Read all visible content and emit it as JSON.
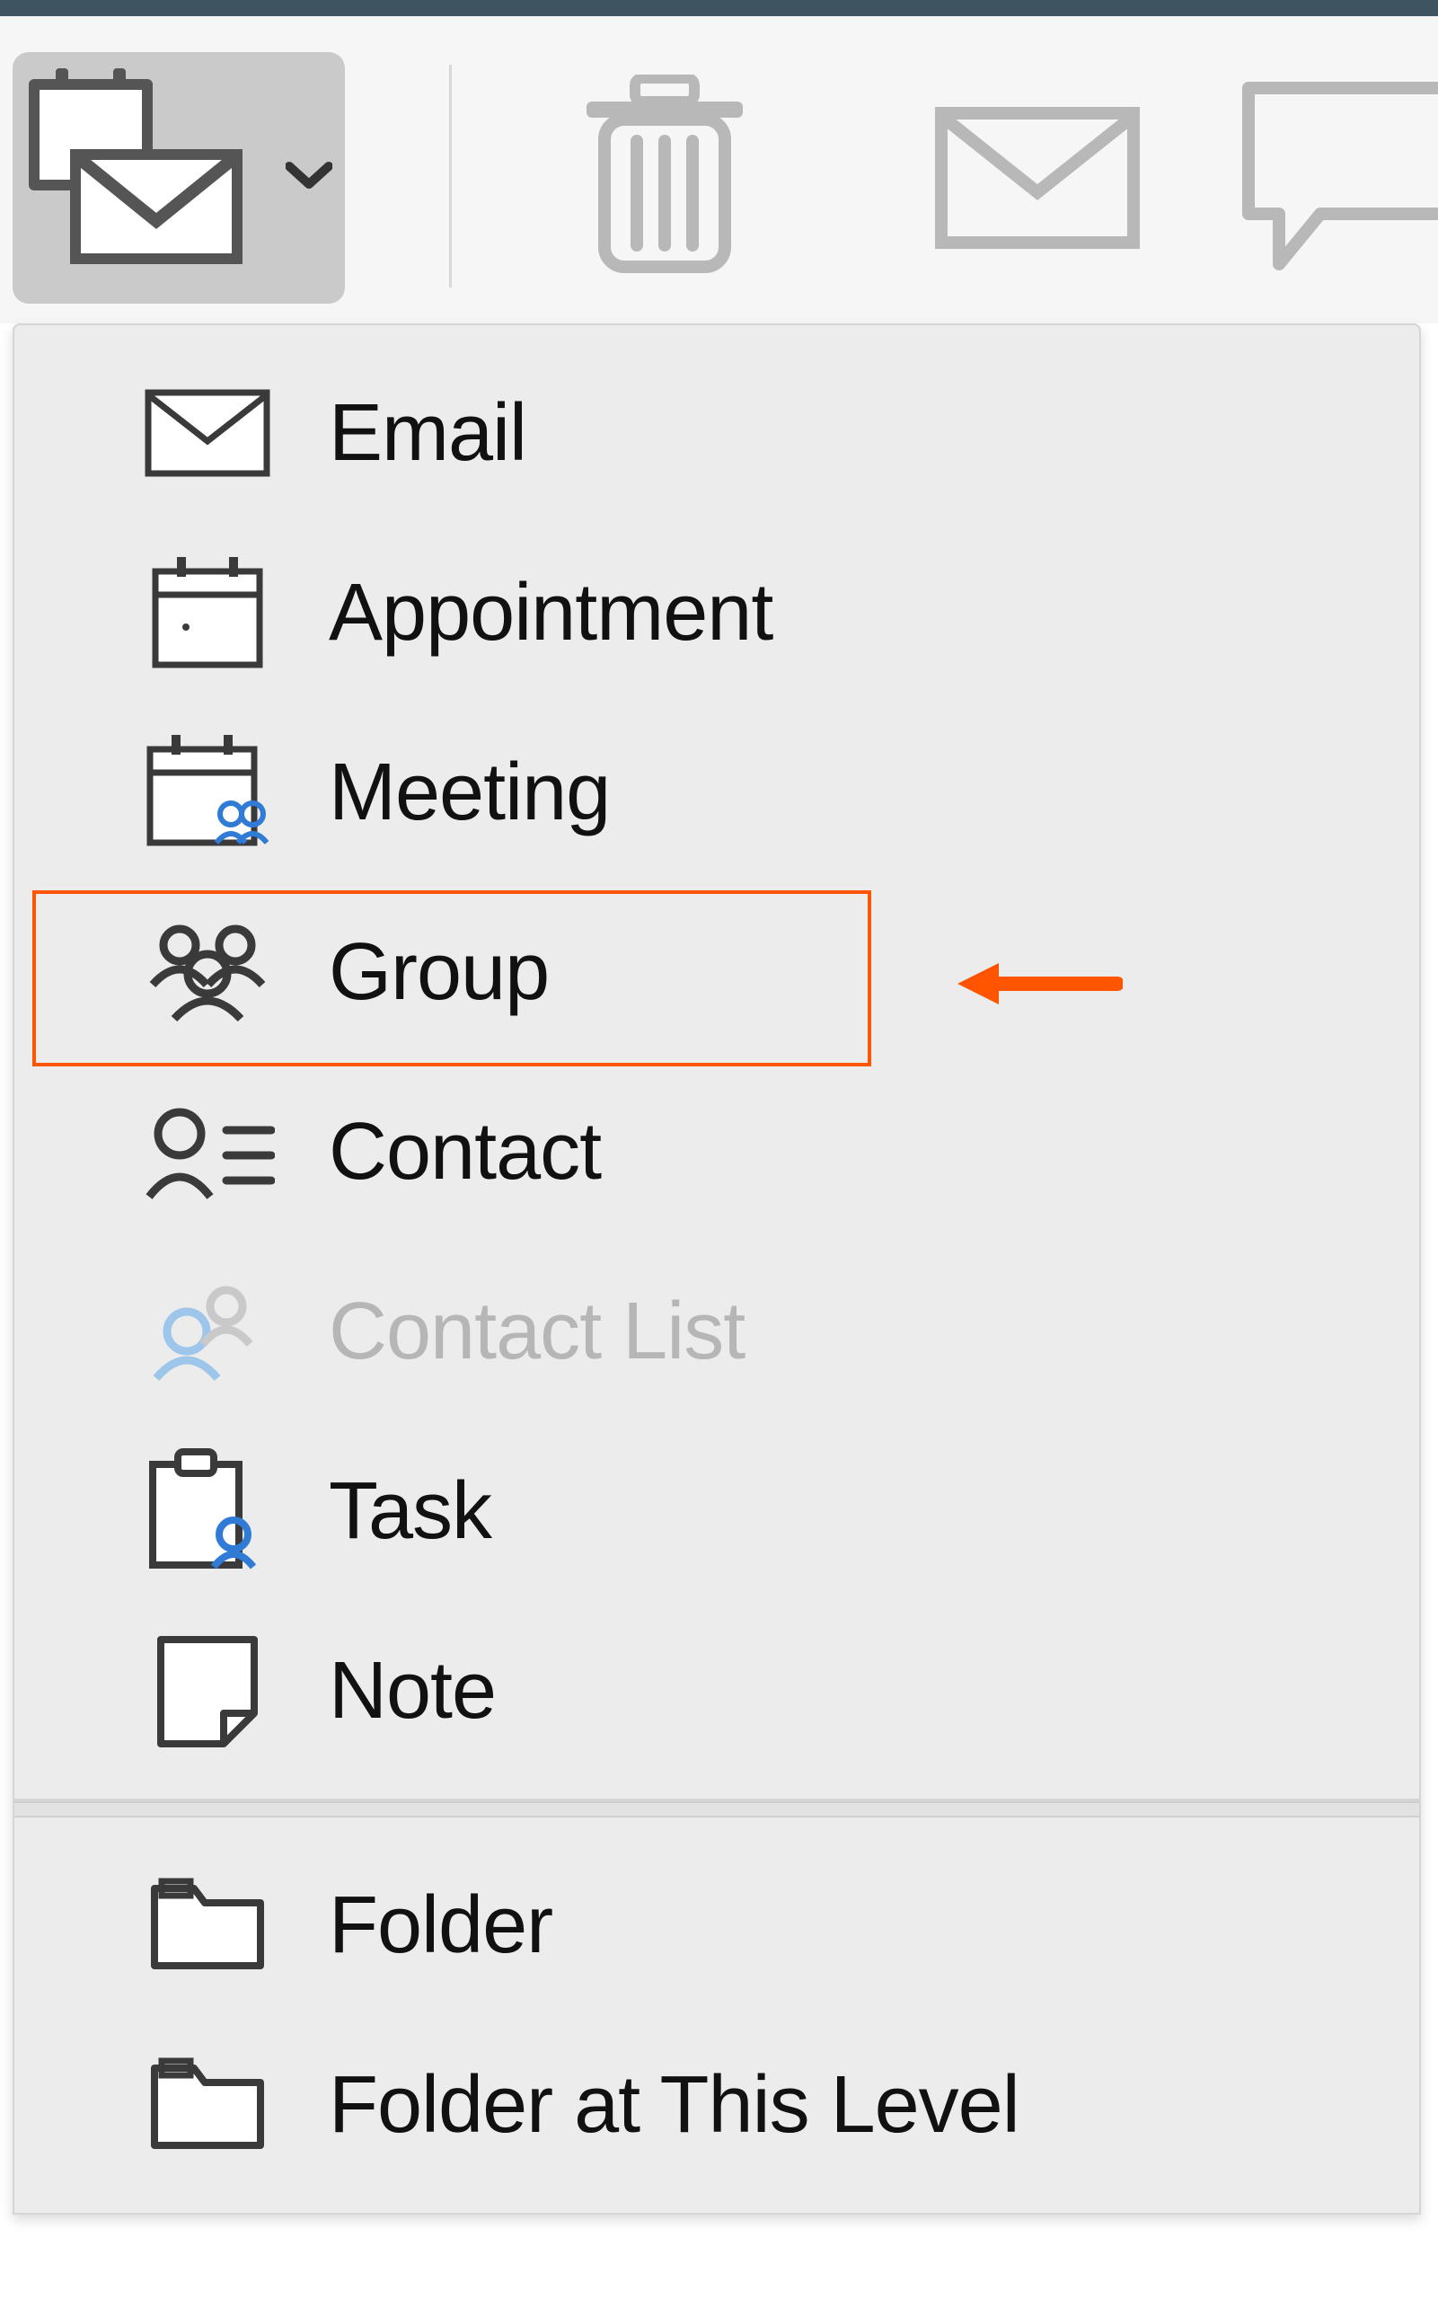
{
  "annotation": {
    "highlighted_item_index": 3,
    "arrow_color": "#ff5400"
  },
  "menu": {
    "section1": [
      {
        "label": "Email",
        "icon": "mail-icon",
        "disabled": false
      },
      {
        "label": "Appointment",
        "icon": "calendar-icon",
        "disabled": false
      },
      {
        "label": "Meeting",
        "icon": "meeting-icon",
        "disabled": false
      },
      {
        "label": "Group",
        "icon": "group-icon",
        "disabled": false
      },
      {
        "label": "Contact",
        "icon": "contact-icon",
        "disabled": false
      },
      {
        "label": "Contact List",
        "icon": "contact-list-icon",
        "disabled": true
      },
      {
        "label": "Task",
        "icon": "task-icon",
        "disabled": false
      },
      {
        "label": "Note",
        "icon": "note-icon",
        "disabled": false
      }
    ],
    "section2": [
      {
        "label": "Folder",
        "icon": "folder-icon",
        "disabled": false
      },
      {
        "label": "Folder at This Level",
        "icon": "folder-level-icon",
        "disabled": false
      }
    ]
  }
}
